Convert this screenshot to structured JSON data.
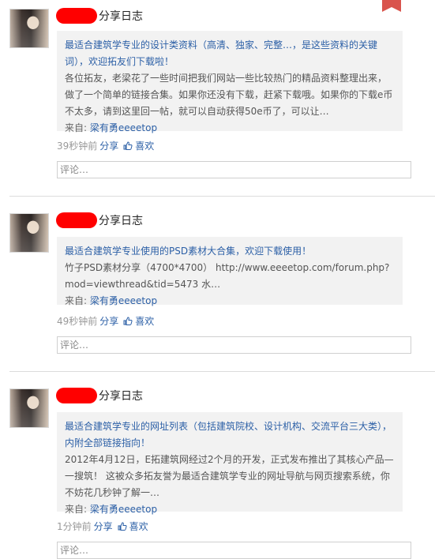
{
  "posts": [
    {
      "action": "分享日志",
      "title": "最适合建筑学专业的设计类资料（高清、独家、完整…，是这些资料的关键词），欢迎拓友们下载啦！",
      "body": "各位拓友，老梁花了一些时间把我们网站一些比较热门的精品资料整理出来，做了一个简单的链接合集。如果你还没有下载，赶紧下载哦。如果你的下载e币不太多，请到这里回一帖，就可以自动获得50e币了，可以让…",
      "source_label": "来自:",
      "source_name": "梁有勇eeeetop",
      "time": "39秒钟前",
      "share": "分享",
      "like": "喜欢",
      "comment_placeholder": "评论…"
    },
    {
      "action": "分享日志",
      "title": "最适合建筑学专业使用的PSD素材大合集，欢迎下载使用！",
      "body": "竹子PSD素材分享（4700*4700） http://www.eeeetop.com/forum.php?mod=viewthread&tid=5473 水…",
      "source_label": "来自:",
      "source_name": "梁有勇eeeetop",
      "time": "49秒钟前",
      "share": "分享",
      "like": "喜欢",
      "comment_placeholder": "评论…"
    },
    {
      "action": "分享日志",
      "title": "最适合建筑学专业的网址列表（包括建筑院校、设计机构、交流平台三大类），内附全部链接指向！",
      "body": "2012年4月12日，E拓建筑网经过2个月的开发，正式发布推出了其核心产品—一搜筑！ 这被众多拓友誉为最适合建筑学专业的网址导航与网页搜索系统，你不妨花几秒钟了解一…",
      "source_label": "来自:",
      "source_name": "梁有勇eeeetop",
      "time": "1分钟前",
      "share": "分享",
      "like": "喜欢",
      "comment_placeholder": "评论…"
    }
  ],
  "colors": {
    "link": "#2b5fa6",
    "redaction": "#ff0000",
    "flag": "#d9544d"
  },
  "icons": {
    "like": "thumbs-up-icon",
    "flag": "bookmark-flag-icon"
  }
}
